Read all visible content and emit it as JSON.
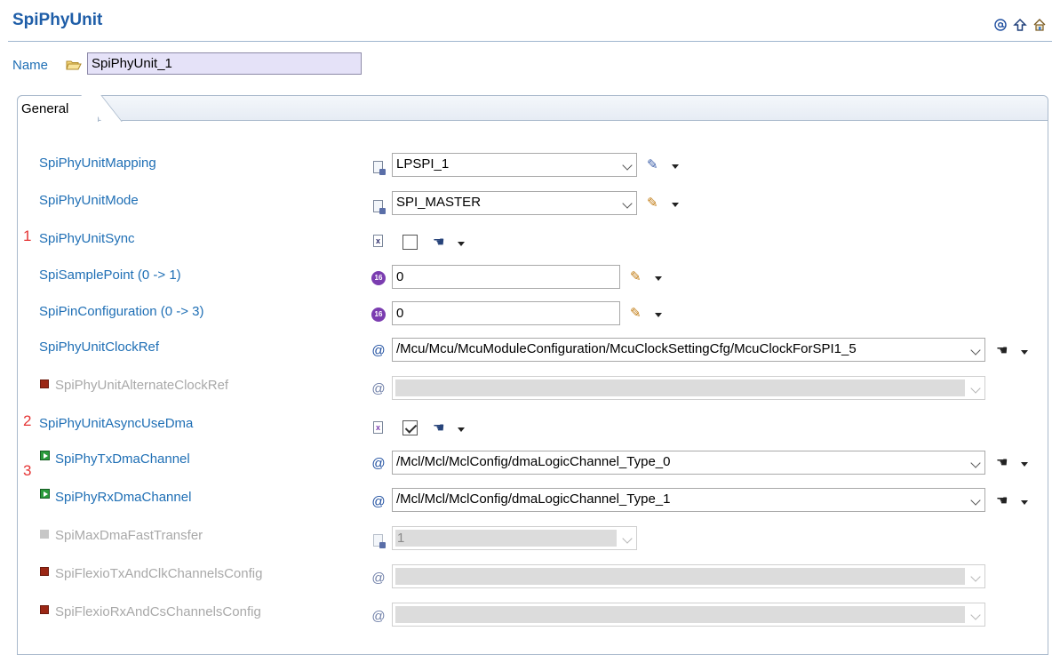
{
  "title": "SpiPhyUnit",
  "name_field": {
    "label": "Name",
    "value": "SpiPhyUnit_1"
  },
  "tabs": [
    {
      "label": "General",
      "active": true
    }
  ],
  "rows": [
    {
      "label": "SpiPhyUnitMapping",
      "value": "LPSPI_1",
      "control": "combo",
      "enabled": true
    },
    {
      "label": "SpiPhyUnitMode",
      "value": "SPI_MASTER",
      "control": "combo",
      "enabled": true
    },
    {
      "label": "SpiPhyUnitSync",
      "marker": "1",
      "control": "checkbox",
      "checked": false,
      "enabled": true
    },
    {
      "label": "SpiSamplePoint (0 -> 1)",
      "value": "0",
      "control": "text",
      "enabled": true
    },
    {
      "label": "SpiPinConfiguration (0 -> 3)",
      "value": "0",
      "control": "text",
      "enabled": true
    },
    {
      "label": "SpiPhyUnitClockRef",
      "value": "/Mcu/Mcu/McuModuleConfiguration/McuClockSettingCfg/McuClockForSPI1_5",
      "control": "combo",
      "enabled": true
    },
    {
      "label": "SpiPhyUnitAlternateClockRef",
      "value": "",
      "control": "combo",
      "enabled": false
    },
    {
      "label": "SpiPhyUnitAsyncUseDma",
      "marker": "2",
      "control": "checkbox",
      "checked": true,
      "enabled": true
    },
    {
      "label": "SpiPhyTxDmaChannel",
      "marker": "3",
      "value": "/Mcl/Mcl/MclConfig/dmaLogicChannel_Type_0",
      "control": "combo",
      "enabled": true
    },
    {
      "label": "SpiPhyRxDmaChannel",
      "value": "/Mcl/Mcl/MclConfig/dmaLogicChannel_Type_1",
      "control": "combo",
      "enabled": true
    },
    {
      "label": "SpiMaxDmaFastTransfer",
      "value": "1",
      "control": "combo",
      "enabled": false
    },
    {
      "label": "SpiFlexioTxAndClkChannelsConfig",
      "value": "",
      "control": "combo",
      "enabled": false
    },
    {
      "label": "SpiFlexioRxAndCsChannelsConfig",
      "value": "",
      "control": "combo",
      "enabled": false
    }
  ],
  "icons": {
    "header": [
      "at-sign-icon",
      "up-arrow-icon",
      "home-icon"
    ],
    "name": "folder-icon",
    "type": [
      "enum-icon",
      "enum-icon",
      "boolean-icon",
      "integer-icon",
      "integer-icon",
      "reference-icon",
      "reference-icon",
      "boolean-icon",
      "reference-icon",
      "reference-icon",
      "integer-list-icon",
      "reference-icon",
      "reference-icon"
    ]
  },
  "colors": {
    "label": "#1f6fb5",
    "disabled_label": "#a9a9a9",
    "marker": "#e53535",
    "title": "#1f5ea8"
  }
}
